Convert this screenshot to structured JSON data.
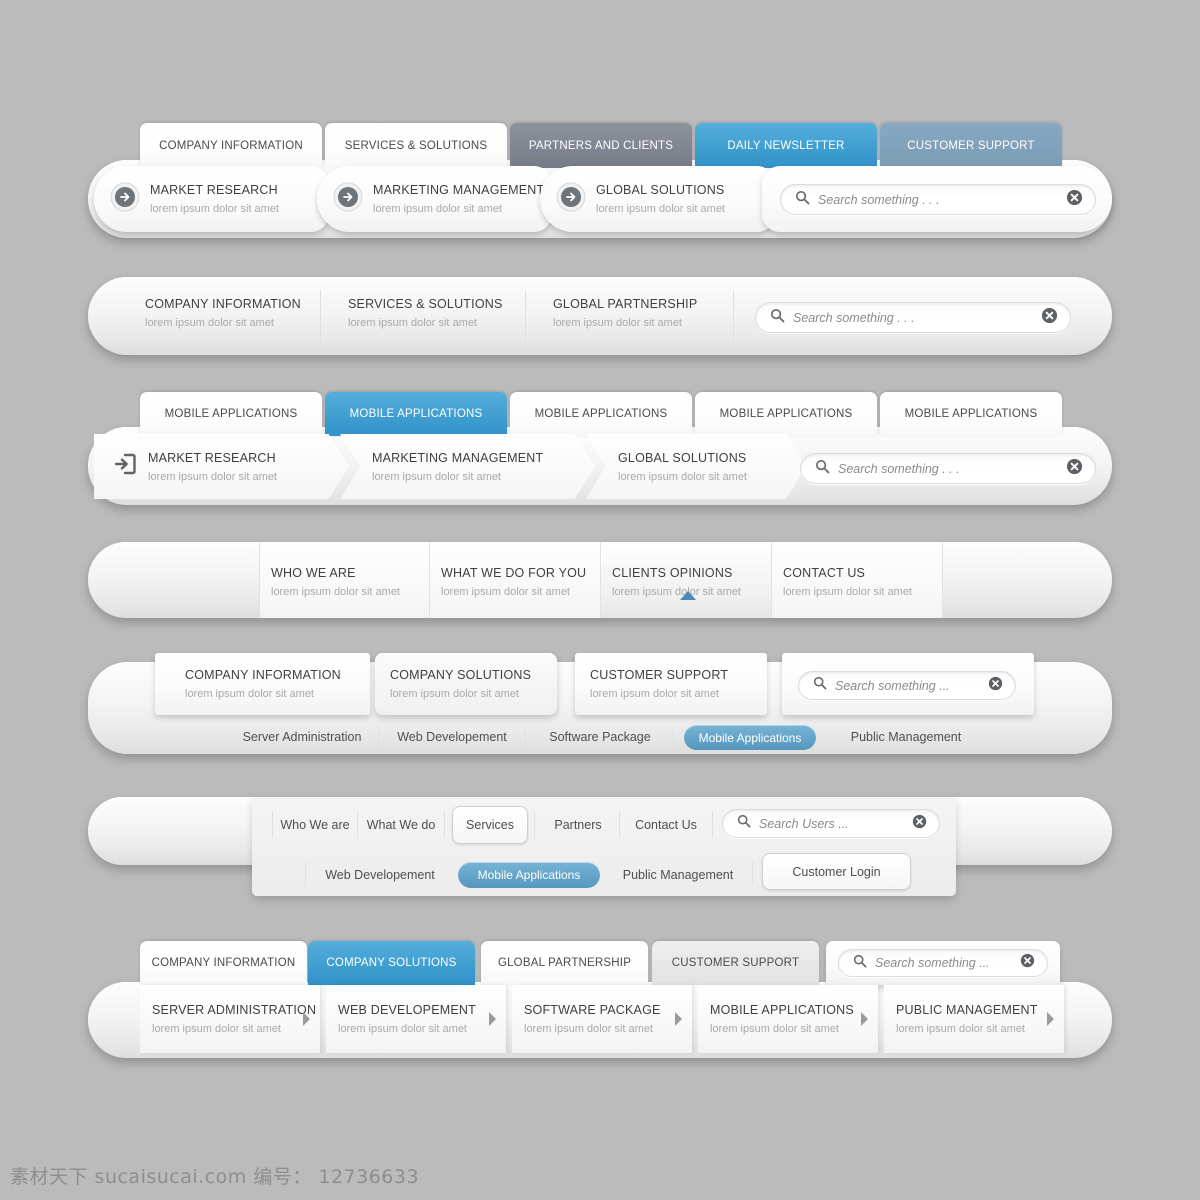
{
  "page": {
    "background_color": "#bbbbbb",
    "accent_blue": "#2f92c8",
    "accent_blue_light": "#55aedb",
    "accent_gray": "#767c87",
    "accent_bluegray": "#7d9cb4"
  },
  "bar1": {
    "tabs": [
      {
        "label": "COMPANY INFORMATION",
        "style": "white"
      },
      {
        "label": "SERVICES & SOLUTIONS",
        "style": "white"
      },
      {
        "label": "PARTNERS AND CLIENTS",
        "style": "gray"
      },
      {
        "label": "DAILY NEWSLETTER",
        "style": "blue"
      },
      {
        "label": "CUSTOMER SUPPORT",
        "style": "bluegray"
      }
    ],
    "items": [
      {
        "title": "MARKET RESEARCH",
        "sub": "lorem ipsum dolor sit amet",
        "icon": "circle-arrow-right-icon"
      },
      {
        "title": "MARKETING MANAGEMENT",
        "sub": "lorem ipsum dolor sit amet",
        "icon": "circle-arrow-right-icon"
      },
      {
        "title": "GLOBAL SOLUTIONS",
        "sub": "lorem ipsum dolor sit amet",
        "icon": "circle-arrow-right-icon"
      }
    ],
    "search": {
      "placeholder": "Search something . . .",
      "value": ""
    }
  },
  "bar2": {
    "items": [
      {
        "title": "COMPANY INFORMATION",
        "sub": "lorem ipsum dolor sit amet"
      },
      {
        "title": "SERVICES & SOLUTIONS",
        "sub": "lorem ipsum dolor sit amet"
      },
      {
        "title": "GLOBAL PARTNERSHIP",
        "sub": "lorem ipsum dolor sit amet"
      }
    ],
    "search": {
      "placeholder": "Search something . . .",
      "value": ""
    }
  },
  "bar3": {
    "tabs": [
      {
        "label": "MOBILE APPLICATIONS",
        "style": "white"
      },
      {
        "label": "MOBILE APPLICATIONS",
        "style": "blue"
      },
      {
        "label": "MOBILE APPLICATIONS",
        "style": "white"
      },
      {
        "label": "MOBILE APPLICATIONS",
        "style": "white"
      },
      {
        "label": "MOBILE APPLICATIONS",
        "style": "white"
      }
    ],
    "items": [
      {
        "title": "MARKET RESEARCH",
        "sub": "lorem ipsum dolor sit amet",
        "icon": "login-enter-icon"
      },
      {
        "title": "MARKETING MANAGEMENT",
        "sub": "lorem ipsum dolor sit amet"
      },
      {
        "title": "GLOBAL SOLUTIONS",
        "sub": "lorem ipsum dolor sit amet"
      }
    ],
    "search": {
      "placeholder": "Search something . . .",
      "value": ""
    }
  },
  "bar4": {
    "items": [
      {
        "title": "WHO WE ARE",
        "sub": "lorem ipsum dolor sit amet",
        "active": false
      },
      {
        "title": "WHAT WE DO FOR YOU",
        "sub": "lorem ipsum dolor sit amet",
        "active": false
      },
      {
        "title": "CLIENTS OPINIONS",
        "sub": "lorem ipsum dolor sit amet",
        "active": true
      },
      {
        "title": "CONTACT US",
        "sub": "lorem ipsum dolor sit amet",
        "active": false
      }
    ]
  },
  "bar5": {
    "items": [
      {
        "title": "COMPANY INFORMATION",
        "sub": "lorem ipsum dolor sit amet",
        "active": false
      },
      {
        "title": "COMPANY SOLUTIONS",
        "sub": "lorem ipsum dolor sit amet",
        "active": true
      },
      {
        "title": "CUSTOMER SUPPORT",
        "sub": "lorem ipsum dolor sit amet",
        "active": false
      }
    ],
    "search": {
      "placeholder": "Search something ...",
      "value": ""
    },
    "sublinks": [
      {
        "label": "Server Administration",
        "active": false
      },
      {
        "label": "Web Developement",
        "active": false
      },
      {
        "label": "Software Package",
        "active": false
      },
      {
        "label": "Mobile Applications",
        "active": true
      },
      {
        "label": "Public Management",
        "active": false
      }
    ]
  },
  "bar6": {
    "links": [
      {
        "label": "Who We are",
        "active": false
      },
      {
        "label": "What We do",
        "active": false
      },
      {
        "label": "Services",
        "active": true
      },
      {
        "label": "Partners",
        "active": false
      },
      {
        "label": "Contact Us",
        "active": false
      }
    ],
    "search": {
      "placeholder": "Search Users ...",
      "value": ""
    },
    "sublinks": [
      {
        "label": "Web Developement",
        "active": false
      },
      {
        "label": "Mobile Applications",
        "active": true
      },
      {
        "label": "Public Management",
        "active": false
      }
    ],
    "login_button": "Customer Login"
  },
  "bar7": {
    "tabs": [
      {
        "label": "COMPANY INFORMATION",
        "style": "white"
      },
      {
        "label": "COMPANY SOLUTIONS",
        "style": "blue"
      },
      {
        "label": "GLOBAL PARTNERSHIP",
        "style": "white"
      },
      {
        "label": "CUSTOMER SUPPORT",
        "style": "lightgray"
      }
    ],
    "search": {
      "placeholder": "Search something ...",
      "value": ""
    },
    "items": [
      {
        "title": "SERVER ADMINISTRATION",
        "sub": "lorem ipsum dolor sit amet"
      },
      {
        "title": "WEB DEVELOPEMENT",
        "sub": "lorem ipsum dolor sit amet"
      },
      {
        "title": "SOFTWARE PACKAGE",
        "sub": "lorem ipsum dolor sit amet"
      },
      {
        "title": "MOBILE APPLICATIONS",
        "sub": "lorem ipsum dolor sit amet"
      },
      {
        "title": "PUBLIC MANAGEMENT",
        "sub": "lorem ipsum dolor sit amet"
      }
    ]
  },
  "watermark": "素材天下 sucaisucai.com  编号： 12736633"
}
